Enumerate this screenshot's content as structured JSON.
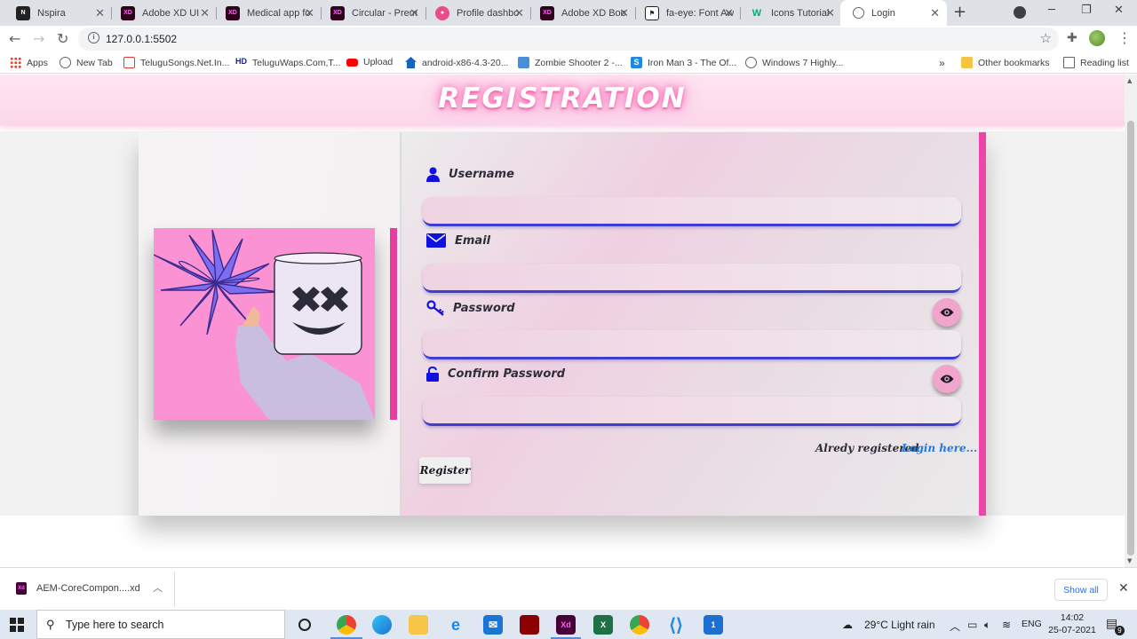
{
  "browser": {
    "tabs": [
      {
        "title": "Nspira",
        "icon": "nspira-icon"
      },
      {
        "title": "Adobe XD UI",
        "icon": "adobe-xd-icon"
      },
      {
        "title": "Medical app fo",
        "icon": "adobe-xd-icon"
      },
      {
        "title": "Circular - Prem",
        "icon": "adobe-xd-icon"
      },
      {
        "title": "Profile dashbo",
        "icon": "dribbble-icon"
      },
      {
        "title": "Adobe XD Boo",
        "icon": "adobe-xd-icon"
      },
      {
        "title": "fa-eye: Font Aw",
        "icon": "font-awesome-flag-icon"
      },
      {
        "title": "Icons Tutorial",
        "icon": "w3schools-icon"
      },
      {
        "title": "Login",
        "icon": "globe-icon"
      }
    ],
    "url": "127.0.0.1:5502",
    "bookmarks": [
      {
        "label": "Apps",
        "icon": "apps-grid-icon"
      },
      {
        "label": "New Tab",
        "icon": "globe-icon"
      },
      {
        "label": "TeluguSongs.Net.In...",
        "icon": "music-icon"
      },
      {
        "label": "TeluguWaps.Com,T...",
        "icon": "hd-icon"
      },
      {
        "label": "Upload",
        "icon": "youtube-icon"
      },
      {
        "label": "android-x86-4.3-20...",
        "icon": "house-icon"
      },
      {
        "label": "Zombie Shooter 2 -...",
        "icon": "zombie-icon"
      },
      {
        "label": "Iron Man 3 - The Of...",
        "icon": "s-icon"
      },
      {
        "label": "Windows 7 Highly...",
        "icon": "globe-icon"
      }
    ],
    "more_bookmarks": "»",
    "other_bookmarks": "Other bookmarks",
    "reading_list": "Reading list"
  },
  "page": {
    "title": "REGISTRATION",
    "fields": [
      {
        "label": "Username",
        "icon": "user-icon",
        "value": "",
        "has_eye": false
      },
      {
        "label": "Email",
        "icon": "envelope-icon",
        "value": "",
        "has_eye": false
      },
      {
        "label": "Password",
        "icon": "key-icon",
        "value": "",
        "has_eye": true
      },
      {
        "label": "Confirm Password",
        "icon": "unlock-icon",
        "value": "",
        "has_eye": true
      }
    ],
    "already_registered": "Alredy registered",
    "login_link": "Login here...",
    "register_button": "Register",
    "colors": {
      "accent_pink": "#ec47a8",
      "illustration_bg": "#fb92d3",
      "icon_blue": "#1010e0",
      "link_blue": "#2378e0"
    }
  },
  "downloads": {
    "file": "AEM-CoreCompon....xd",
    "show_all": "Show all"
  },
  "taskbar": {
    "search_placeholder": "Type here to search",
    "weather": "29°C  Light rain",
    "language": "ENG",
    "time": "14:02",
    "date": "25-07-2021",
    "notification_count": "9"
  }
}
